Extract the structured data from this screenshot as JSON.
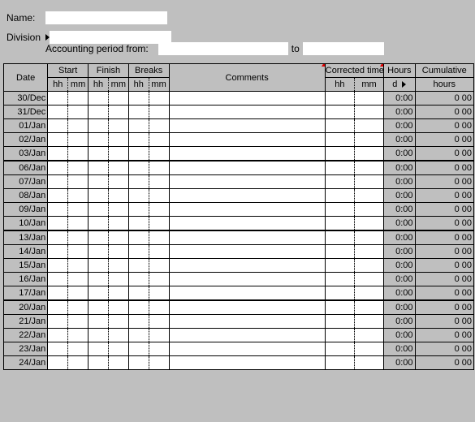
{
  "hdr": {
    "name_lbl": "Name:",
    "division_lbl": "Division",
    "period_lbl": "Accounting period from:",
    "to_lbl": "to",
    "name_val": "",
    "division_val": "",
    "period_from": "",
    "period_to": ""
  },
  "cols": {
    "date": "Date",
    "start": "Start",
    "finish": "Finish",
    "breaks": "Breaks",
    "comments": "Comments",
    "corrected": "Corrected time",
    "hours": "Hours",
    "cum": "Cumulative",
    "hh": "hh",
    "mm": "mm",
    "d": "d",
    "hours2": "hours"
  },
  "rows": [
    {
      "date": "30/Dec",
      "hd": "0:00",
      "ch": "0 00",
      "gap": false
    },
    {
      "date": "31/Dec",
      "hd": "0:00",
      "ch": "0 00",
      "gap": false
    },
    {
      "date": "01/Jan",
      "hd": "0:00",
      "ch": "0 00",
      "gap": false
    },
    {
      "date": "02/Jan",
      "hd": "0:00",
      "ch": "0 00",
      "gap": false
    },
    {
      "date": "03/Jan",
      "hd": "0:00",
      "ch": "0 00",
      "gap": false
    },
    {
      "date": "06/Jan",
      "hd": "0:00",
      "ch": "0 00",
      "gap": true
    },
    {
      "date": "07/Jan",
      "hd": "0:00",
      "ch": "0 00",
      "gap": false
    },
    {
      "date": "08/Jan",
      "hd": "0:00",
      "ch": "0 00",
      "gap": false
    },
    {
      "date": "09/Jan",
      "hd": "0:00",
      "ch": "0 00",
      "gap": false
    },
    {
      "date": "10/Jan",
      "hd": "0:00",
      "ch": "0 00",
      "gap": false
    },
    {
      "date": "13/Jan",
      "hd": "0:00",
      "ch": "0 00",
      "gap": true
    },
    {
      "date": "14/Jan",
      "hd": "0:00",
      "ch": "0 00",
      "gap": false
    },
    {
      "date": "15/Jan",
      "hd": "0:00",
      "ch": "0 00",
      "gap": false
    },
    {
      "date": "16/Jan",
      "hd": "0:00",
      "ch": "0 00",
      "gap": false
    },
    {
      "date": "17/Jan",
      "hd": "0:00",
      "ch": "0 00",
      "gap": false
    },
    {
      "date": "20/Jan",
      "hd": "0:00",
      "ch": "0 00",
      "gap": true
    },
    {
      "date": "21/Jan",
      "hd": "0:00",
      "ch": "0 00",
      "gap": false
    },
    {
      "date": "22/Jan",
      "hd": "0:00",
      "ch": "0 00",
      "gap": false
    },
    {
      "date": "23/Jan",
      "hd": "0:00",
      "ch": "0 00",
      "gap": false
    },
    {
      "date": "24/Jan",
      "hd": "0:00",
      "ch": "0 00",
      "gap": false
    }
  ]
}
